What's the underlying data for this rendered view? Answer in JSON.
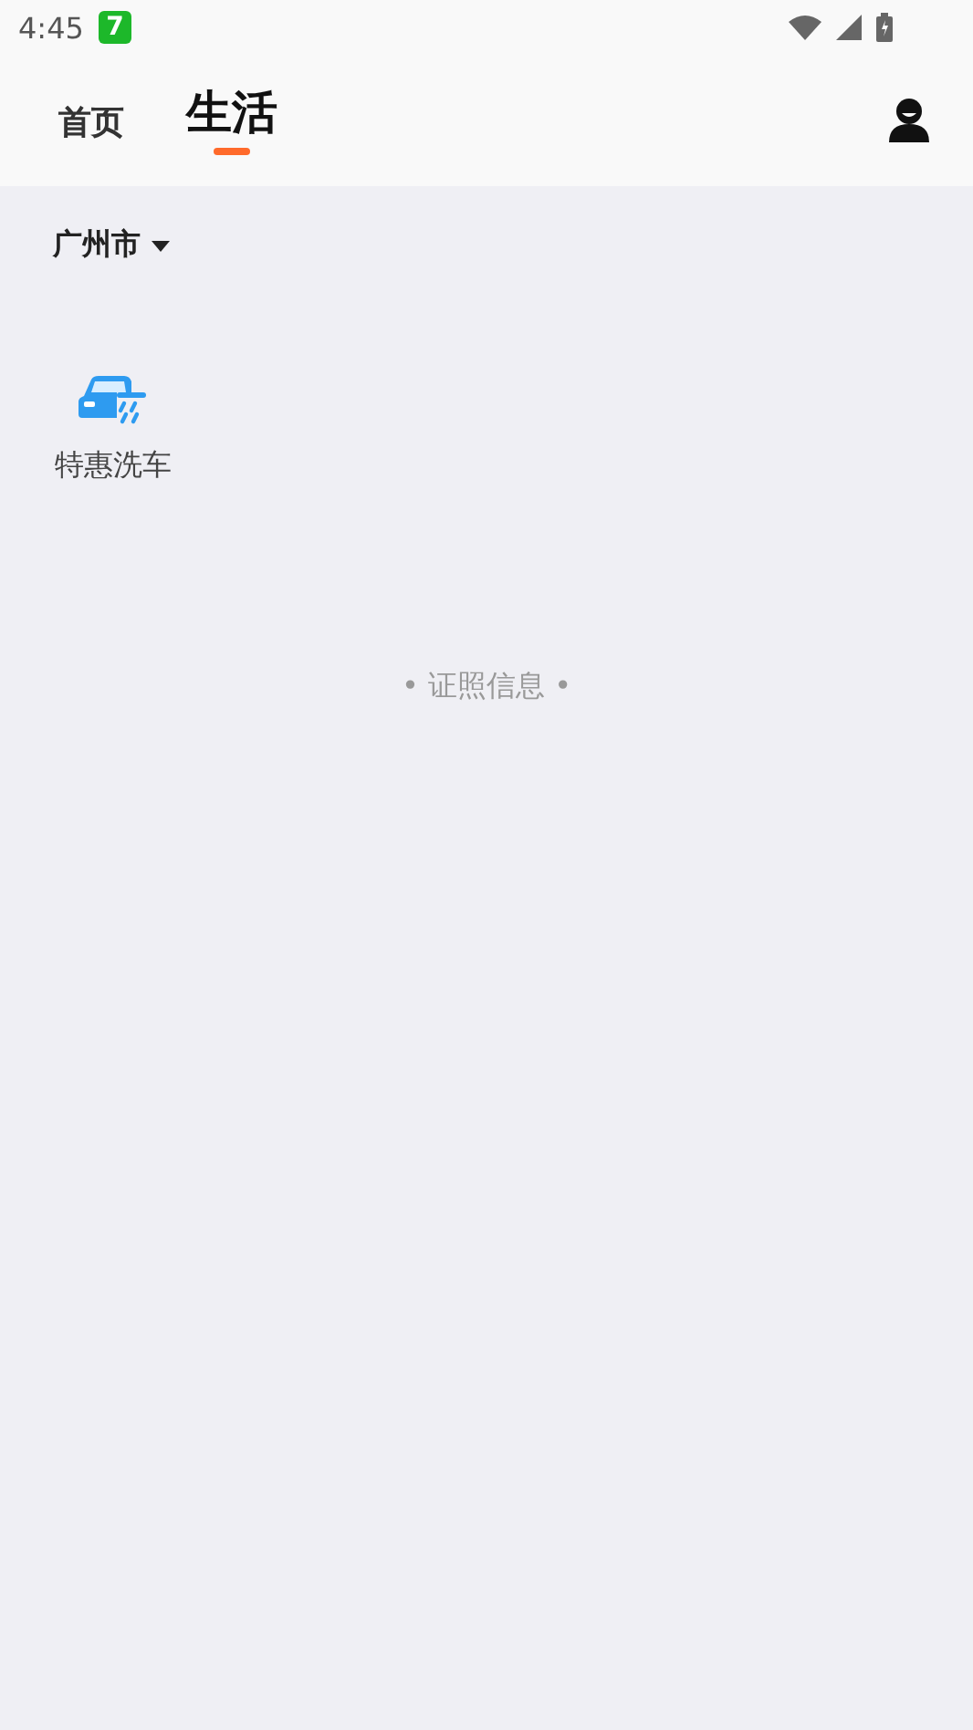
{
  "status_bar": {
    "time": "4:45",
    "notification_badge": "7"
  },
  "tabs": [
    {
      "label": "首页",
      "selected": false
    },
    {
      "label": "生活",
      "selected": true
    }
  ],
  "city": {
    "label": "广州市"
  },
  "services": [
    {
      "label": "特惠洗车"
    }
  ],
  "footer": {
    "text": "• 证照信息 •"
  }
}
